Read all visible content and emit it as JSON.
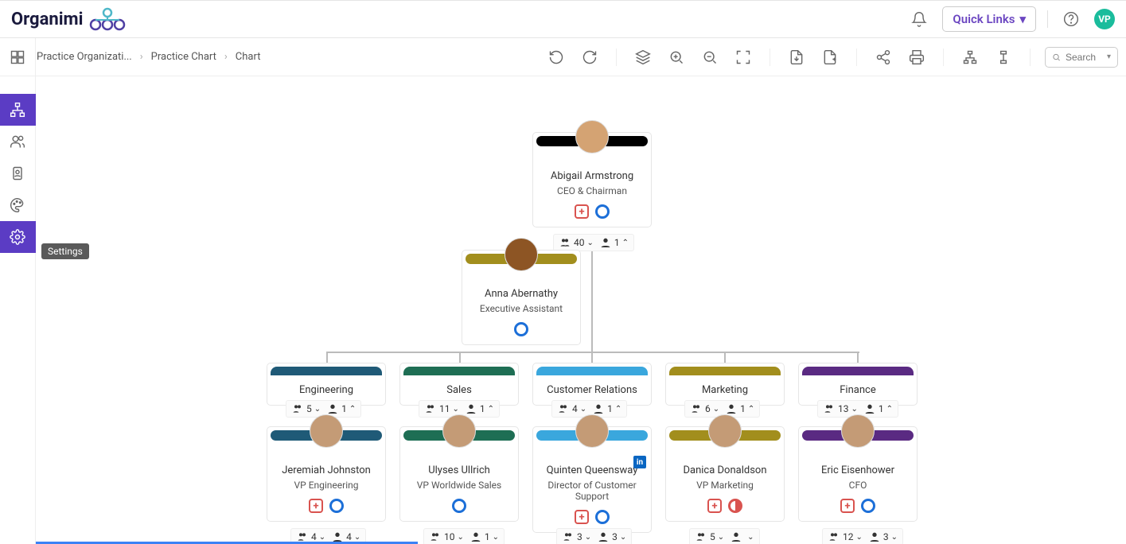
{
  "app": {
    "name": "Organimi"
  },
  "header": {
    "quick_links": "Quick Links",
    "avatar_initials": "VP"
  },
  "breadcrumb": [
    "Practice Organizati...",
    "Practice Chart",
    "Chart"
  ],
  "search": {
    "placeholder": "Search"
  },
  "tooltips": {
    "settings": "Settings"
  },
  "nodes": {
    "ceo": {
      "name": "Abigail Armstrong",
      "title": "CEO & Chairman",
      "color": "#000000",
      "stats": {
        "all": 40,
        "direct": 1
      }
    },
    "ea": {
      "name": "Anna Abernathy",
      "title": "Executive Assistant",
      "color": "#a28e1d"
    },
    "depts": [
      {
        "label": "Engineering",
        "color": "#1f5a77",
        "all": 5,
        "direct": 1
      },
      {
        "label": "Sales",
        "color": "#1e6e54",
        "all": 11,
        "direct": 1
      },
      {
        "label": "Customer Relations",
        "color": "#3aa7dd",
        "all": 4,
        "direct": 1
      },
      {
        "label": "Marketing",
        "color": "#a28e1d",
        "all": 6,
        "direct": 1
      },
      {
        "label": "Finance",
        "color": "#5a2a82",
        "all": 13,
        "direct": 1
      }
    ],
    "vps": [
      {
        "name": "Jeremiah Johnston",
        "title": "VP Engineering",
        "color": "#1f5a77",
        "all": 4,
        "direct": 4
      },
      {
        "name": "Ulyses Ullrich",
        "title": "VP Worldwide Sales",
        "color": "#1e6e54",
        "all": 10,
        "direct": 1
      },
      {
        "name": "Quinten Queensway",
        "title": "Director of Customer Support",
        "color": "#3aa7dd",
        "all": 3,
        "direct": 3,
        "linkedin": true
      },
      {
        "name": "Danica Donaldson",
        "title": "VP Marketing",
        "color": "#a28e1d",
        "all": 5,
        "direct": ""
      },
      {
        "name": "Eric Eisenhower",
        "title": "CFO",
        "color": "#5a2a82",
        "all": 12,
        "direct": 3
      }
    ]
  },
  "chart_data": {
    "type": "org-chart",
    "root": {
      "name": "Abigail Armstrong",
      "title": "CEO & Chairman",
      "total_reports": 40,
      "direct_reports": 1,
      "assistant": {
        "name": "Anna Abernathy",
        "title": "Executive Assistant"
      },
      "children": [
        {
          "department": "Engineering",
          "total": 5,
          "direct": 1,
          "lead": {
            "name": "Jeremiah Johnston",
            "title": "VP Engineering",
            "total": 4,
            "direct": 4
          }
        },
        {
          "department": "Sales",
          "total": 11,
          "direct": 1,
          "lead": {
            "name": "Ulyses Ullrich",
            "title": "VP Worldwide Sales",
            "total": 10,
            "direct": 1
          }
        },
        {
          "department": "Customer Relations",
          "total": 4,
          "direct": 1,
          "lead": {
            "name": "Quinten Queensway",
            "title": "Director of Customer Support",
            "total": 3,
            "direct": 3
          }
        },
        {
          "department": "Marketing",
          "total": 6,
          "direct": 1,
          "lead": {
            "name": "Danica Donaldson",
            "title": "VP Marketing",
            "total": 5
          }
        },
        {
          "department": "Finance",
          "total": 13,
          "direct": 1,
          "lead": {
            "name": "Eric Eisenhower",
            "title": "CFO",
            "total": 12,
            "direct": 3
          }
        }
      ]
    }
  }
}
